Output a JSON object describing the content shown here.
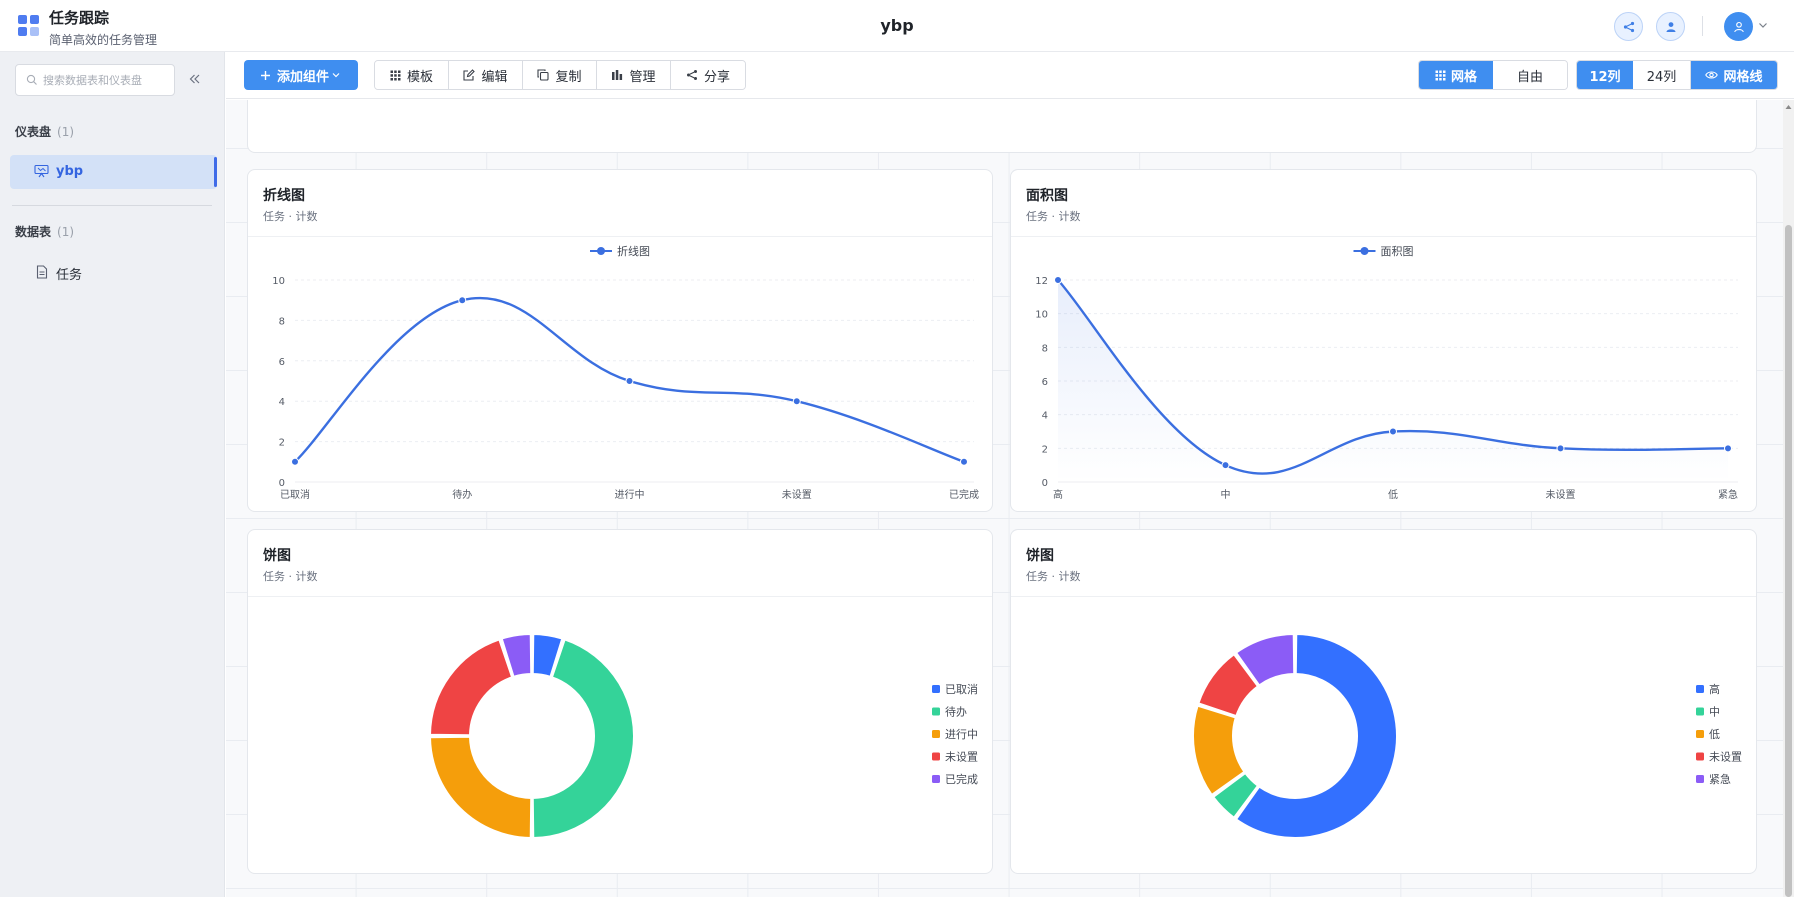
{
  "header": {
    "app_title": "任务跟踪",
    "app_subtitle": "简单高效的任务管理",
    "doc_title": "ybp"
  },
  "sidebar": {
    "search_placeholder": "搜索数据表和仪表盘",
    "dashboards_label": "仪表盘",
    "dashboards_count": "(1)",
    "dashboard_items": [
      {
        "label": "ybp"
      }
    ],
    "tables_label": "数据表",
    "tables_count": "(1)",
    "table_items": [
      {
        "label": "任务"
      }
    ]
  },
  "toolbar": {
    "add_widget": "添加组件",
    "buttons": [
      "模板",
      "编辑",
      "复制",
      "管理",
      "分享"
    ],
    "layout_modes": [
      "网格",
      "自由"
    ],
    "layout_active": "网格",
    "columns": [
      "12列",
      "24列"
    ],
    "columns_active": "12列",
    "gridlines": "网格线"
  },
  "cards": [
    {
      "title": "折线图",
      "subtitle": "任务 · 计数",
      "legend": "折线图"
    },
    {
      "title": "面积图",
      "subtitle": "任务 · 计数",
      "legend": "面积图"
    },
    {
      "title": "饼图",
      "subtitle": "任务 · 计数"
    },
    {
      "title": "饼图",
      "subtitle": "任务 · 计数"
    }
  ],
  "chart_data": [
    {
      "type": "line",
      "title": "折线图",
      "categories": [
        "已取消",
        "待办",
        "进行中",
        "未设置",
        "已完成"
      ],
      "series": [
        {
          "name": "折线图",
          "values": [
            1,
            9,
            5,
            4,
            1
          ]
        }
      ],
      "ylim": [
        0,
        10
      ],
      "yticks": [
        0,
        2,
        4,
        6,
        8,
        10
      ],
      "smooth": true,
      "color": "#3b6fe0",
      "legend_position": "top-center"
    },
    {
      "type": "area",
      "title": "面积图",
      "categories": [
        "高",
        "中",
        "低",
        "未设置",
        "紧急"
      ],
      "series": [
        {
          "name": "面积图",
          "values": [
            12,
            1,
            3,
            2,
            2
          ]
        }
      ],
      "ylim": [
        0,
        12
      ],
      "yticks": [
        0,
        2,
        4,
        6,
        8,
        10,
        12
      ],
      "smooth": true,
      "color": "#3b6fe0",
      "legend_position": "top-center"
    },
    {
      "type": "pie",
      "title": "饼图",
      "donut": true,
      "labels": [
        "已取消",
        "待办",
        "进行中",
        "未设置",
        "已完成"
      ],
      "values": [
        1,
        9,
        5,
        4,
        1
      ],
      "colors": [
        "#3370ff",
        "#34d399",
        "#f59e0b",
        "#ef4444",
        "#8b5cf6"
      ],
      "legend_position": "right"
    },
    {
      "type": "pie",
      "title": "饼图",
      "donut": true,
      "labels": [
        "高",
        "中",
        "低",
        "未设置",
        "紧急"
      ],
      "values": [
        12,
        1,
        3,
        2,
        2
      ],
      "colors": [
        "#3370ff",
        "#34d399",
        "#f59e0b",
        "#ef4444",
        "#8b5cf6"
      ],
      "legend_position": "right"
    }
  ]
}
